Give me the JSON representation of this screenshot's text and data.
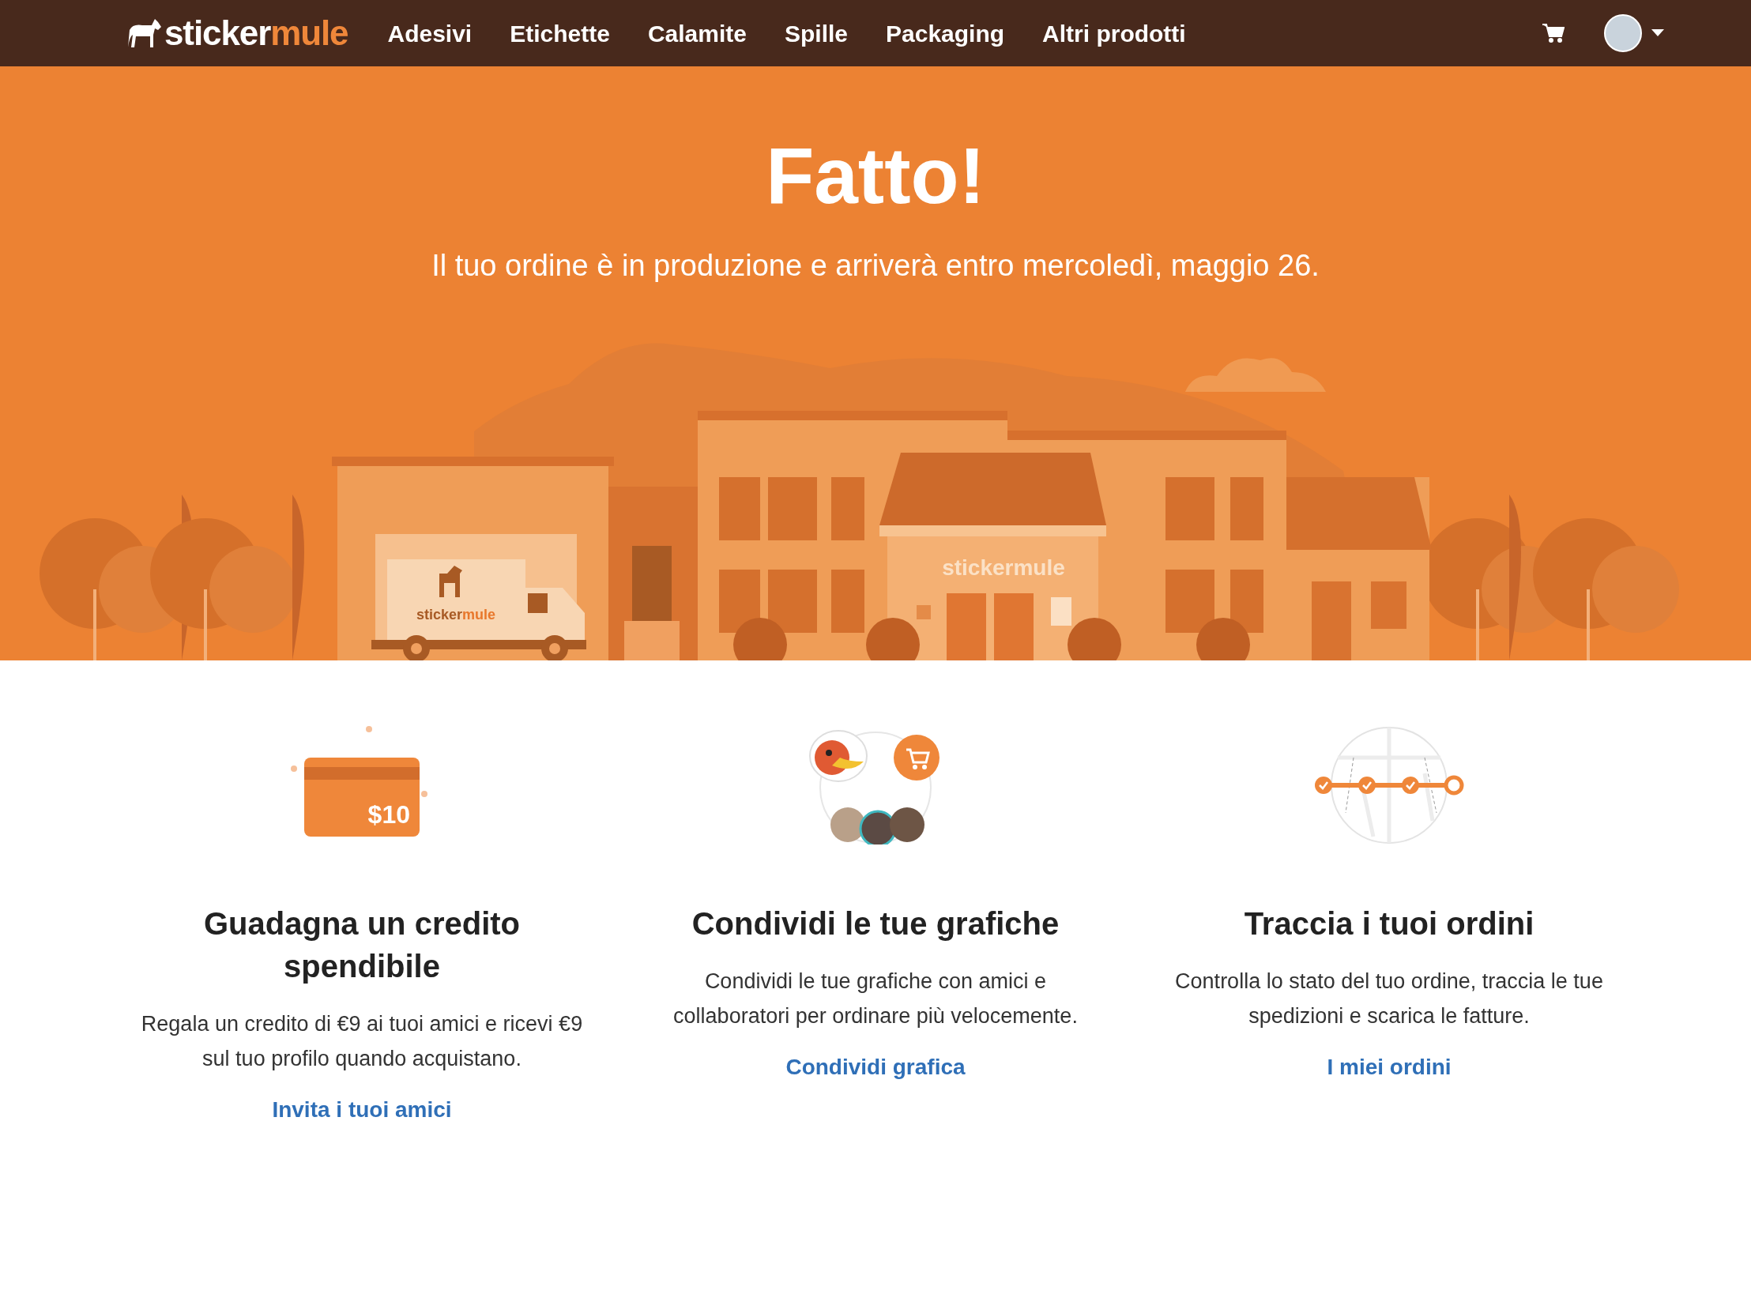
{
  "nav": {
    "logo": {
      "part_1": "sticker",
      "part_2": "mule"
    },
    "items": [
      {
        "label": "Adesivi"
      },
      {
        "label": "Etichette"
      },
      {
        "label": "Calamite"
      },
      {
        "label": "Spille"
      },
      {
        "label": "Packaging"
      },
      {
        "label": "Altri prodotti"
      }
    ]
  },
  "hero": {
    "title": "Fatto!",
    "subtitle": "Il tuo ordine è in produzione e arriverà entro mercoledì, maggio 26.",
    "illustration": {
      "truck_logo": {
        "part_1": "sticker",
        "part_2": "mule"
      },
      "store_sign": "stickermule"
    }
  },
  "features": [
    {
      "kind": "credit",
      "badge": "$10",
      "title": "Guadagna un credito spendibile",
      "text": "Regala un credito di €9 ai tuoi amici e ricevi €9 sul tuo profilo quando acquistano.",
      "link": "Invita i tuoi amici"
    },
    {
      "kind": "share",
      "title": "Condividi le tue grafiche",
      "text": "Condividi le tue grafiche con amici e collaboratori per ordinare più velocemente.",
      "link": "Condividi grafica"
    },
    {
      "kind": "track",
      "title": "Traccia i tuoi ordini",
      "text": "Controlla lo stato del tuo ordine, traccia le tue spedizioni e scarica le fatture.",
      "link": "I miei ordini"
    }
  ]
}
